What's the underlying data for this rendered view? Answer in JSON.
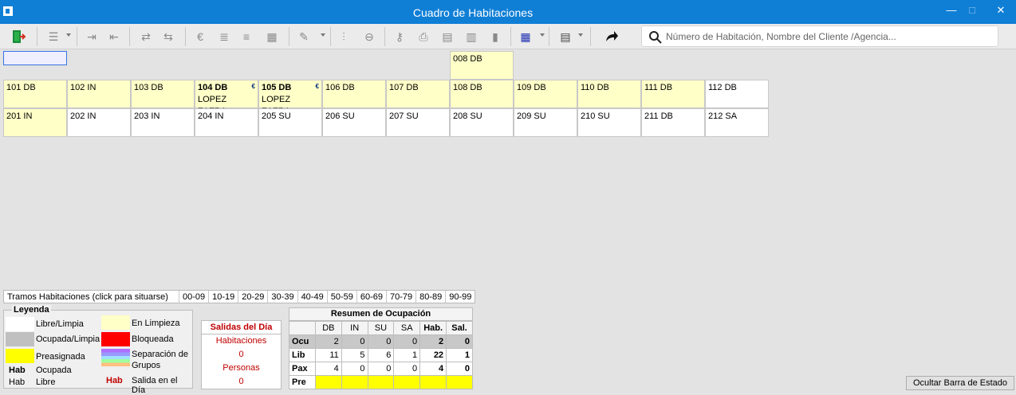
{
  "window": {
    "title": "Cuadro de Habitaciones",
    "minimize": "—",
    "maximize": "□",
    "close": "✕"
  },
  "search": {
    "placeholder": "Número de Habitación, Nombre del Cliente /Agencia..."
  },
  "rooms": {
    "r008": {
      "num": "008 DB"
    },
    "r101": {
      "num": "101 DB"
    },
    "r102": {
      "num": "102 IN"
    },
    "r103": {
      "num": "103 DB"
    },
    "r104": {
      "num": "104 DB",
      "guest": "LOPEZ ZAFRA",
      "badge": "€"
    },
    "r105": {
      "num": "105 DB",
      "guest": "LOPEZ ZAFRA",
      "badge": "€"
    },
    "r106": {
      "num": "106 DB"
    },
    "r107": {
      "num": "107 DB"
    },
    "r108": {
      "num": "108 DB"
    },
    "r109": {
      "num": "109 DB"
    },
    "r110": {
      "num": "110 DB"
    },
    "r111": {
      "num": "111 DB"
    },
    "r112": {
      "num": "112 DB"
    },
    "r201": {
      "num": "201 IN"
    },
    "r202": {
      "num": "202 IN"
    },
    "r203": {
      "num": "203 IN"
    },
    "r204": {
      "num": "204 IN"
    },
    "r205": {
      "num": "205 SU"
    },
    "r206": {
      "num": "206 SU"
    },
    "r207": {
      "num": "207 SU"
    },
    "r208": {
      "num": "208 SU"
    },
    "r209": {
      "num": "209 SU"
    },
    "r210": {
      "num": "210 SU"
    },
    "r211": {
      "num": "211 DB"
    },
    "r212": {
      "num": "212 SA"
    }
  },
  "tramos": {
    "label": "Tramos Habitaciones (click para situarse)",
    "ranges": [
      "00-09",
      "10-19",
      "20-29",
      "30-39",
      "40-49",
      "50-59",
      "60-69",
      "70-79",
      "80-89",
      "90-99"
    ]
  },
  "legend": {
    "title": "Leyenda",
    "libre_limpia": "Libre/Limpia",
    "ocupada_limpia": "Ocupada/Limpia",
    "preasignada": "Preasignada",
    "hab": "Hab",
    "ocupada": "Ocupada",
    "libre": "Libre",
    "en_limpieza": "En Limpieza",
    "bloqueada": "Bloqueada",
    "separacion": "Separación de",
    "grupos": "Grupos",
    "salida": "Salida en el Día",
    "colors": {
      "white": "#ffffff",
      "gray": "#c0c0c0",
      "yellow": "#ffff00",
      "lightyellow": "#ffffc8",
      "red": "#ff0000",
      "salida_red": "#c00000"
    }
  },
  "salidas": {
    "title": "Salidas del Día",
    "habitaciones_label": "Habitaciones",
    "habitaciones": "0",
    "personas_label": "Personas",
    "personas": "0"
  },
  "resumen": {
    "title": "Resumen de Ocupación",
    "headers": [
      "DB",
      "IN",
      "SU",
      "SA",
      "Hab.",
      "Sal."
    ],
    "rows": {
      "ocu": {
        "label": "Ocu",
        "values": [
          "2",
          "0",
          "0",
          "0",
          "2",
          "0"
        ]
      },
      "lib": {
        "label": "Lib",
        "values": [
          "11",
          "5",
          "6",
          "1",
          "22",
          "1"
        ]
      },
      "pax": {
        "label": "Pax",
        "values": [
          "4",
          "0",
          "0",
          "0",
          "4",
          "0"
        ]
      },
      "pre": {
        "label": "Pre",
        "values": [
          "",
          "",
          "",
          "",
          "",
          ""
        ]
      }
    }
  },
  "status_button": "Ocultar Barra de Estado"
}
